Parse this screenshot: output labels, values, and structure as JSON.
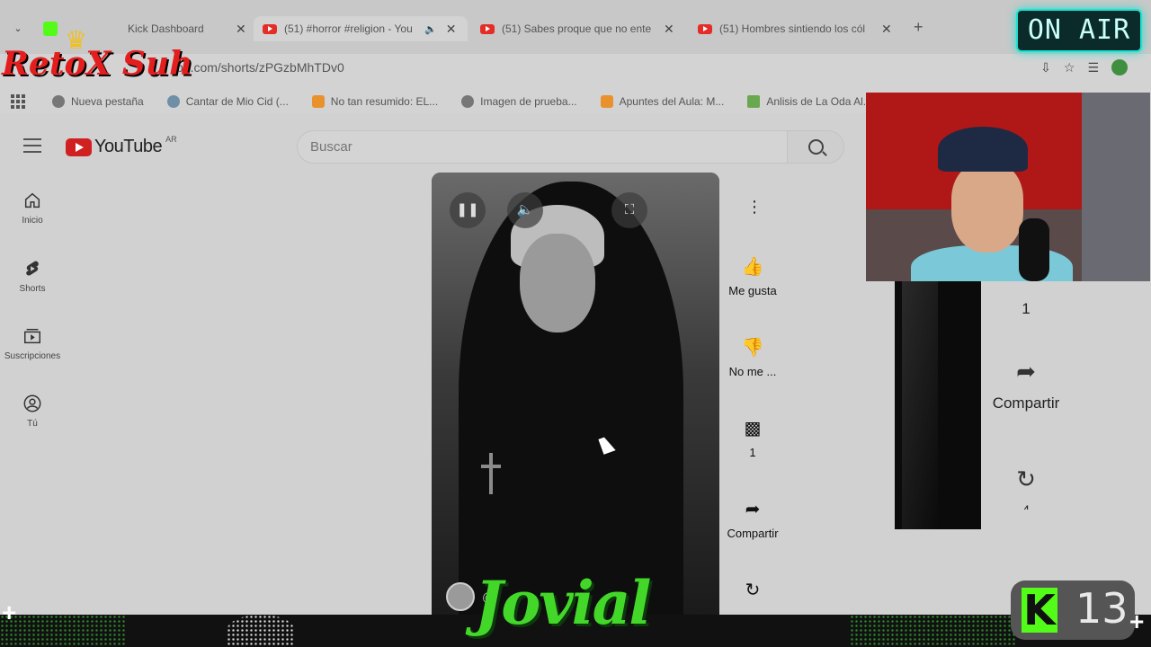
{
  "browser": {
    "tabs": [
      {
        "title": "Kick Dashboard",
        "favicon": "kick-icon",
        "x": 48
      },
      {
        "title": "(51) #horror #religion - You",
        "favicon": "youtube-icon",
        "active": true
      },
      {
        "title": "(51) Sabes proque que no ente",
        "favicon": "youtube-icon"
      },
      {
        "title": "(51) Hombres sintiendo los cól",
        "favicon": "youtube-icon"
      }
    ],
    "url": "be.com/shorts/zPGzbMhTDv0",
    "bookmarks": [
      {
        "label": "Nueva pestaña"
      },
      {
        "label": "Cantar de Mio Cid (..."
      },
      {
        "label": "No tan resumido: EL..."
      },
      {
        "label": "Imagen de prueba..."
      },
      {
        "label": "Apuntes del Aula: M..."
      },
      {
        "label": "Anlisis de La Oda Al..."
      }
    ]
  },
  "youtube": {
    "logo_text": "YouTube",
    "region": "AR",
    "search_placeholder": "Buscar",
    "guide": [
      {
        "label": "Inicio"
      },
      {
        "label": "Shorts"
      },
      {
        "label": "Suscripciones"
      },
      {
        "label": "Tú"
      }
    ],
    "actions": {
      "like": "Me gusta",
      "dislike": "No me ...",
      "comments": "1",
      "share": "Compartir"
    },
    "channel_handle": "@",
    "next": {
      "comments": "1",
      "share": "Compartir",
      "remix": "4"
    }
  },
  "stream_overlay": {
    "on_air": "ON AIR",
    "reto_logo": "RetoX Suh",
    "jovial": "Jovial",
    "kick_count": "13",
    "kick_letter": "K"
  },
  "colors": {
    "youtube_red": "#d02020",
    "kick_green": "#53fc18",
    "onair_cyan": "#1ee0d0"
  }
}
